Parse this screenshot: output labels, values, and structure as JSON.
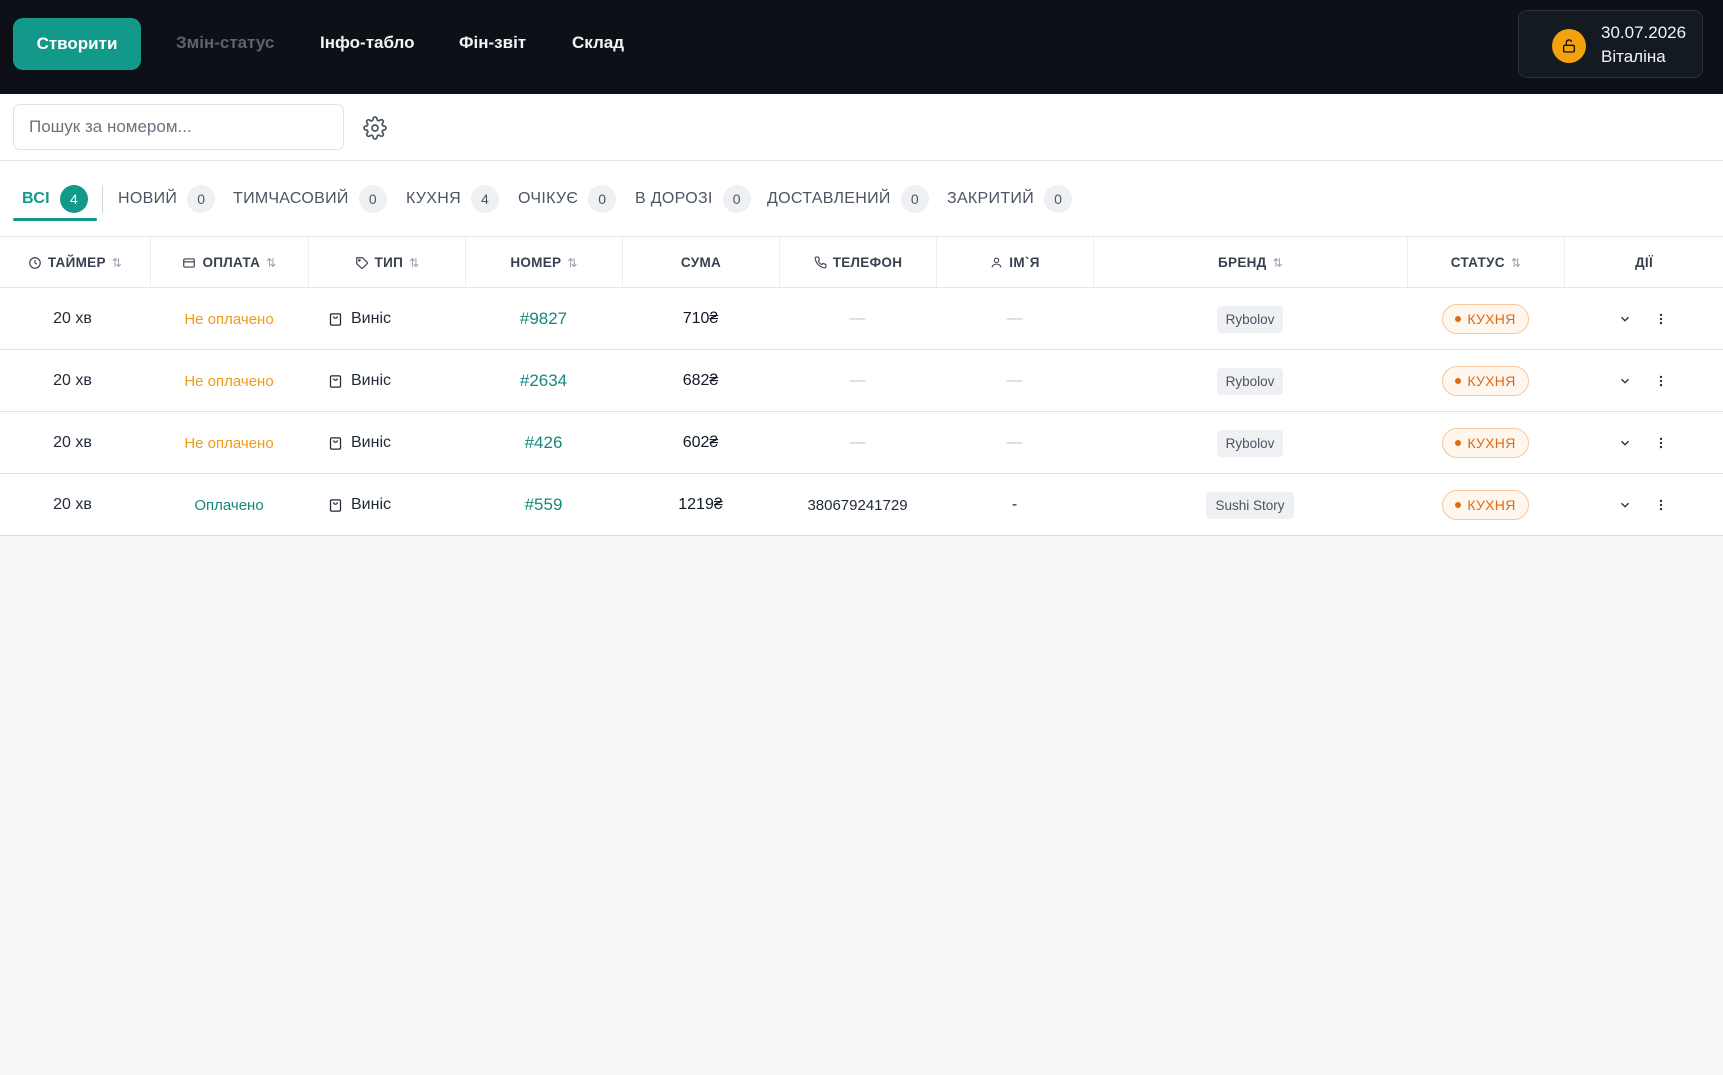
{
  "topbar": {
    "create_label": "Створити",
    "nav": [
      "Змін-статус",
      "Інфо-табло",
      "Фін-звіт",
      "Склад"
    ],
    "user": {
      "date": "30.07.2026",
      "name": "Віталіна"
    }
  },
  "search": {
    "placeholder": "Пошук за номером..."
  },
  "tabs": [
    {
      "label": "ВСІ",
      "count": "4"
    },
    {
      "label": "НОВИЙ",
      "count": "0"
    },
    {
      "label": "ТИМЧАСОВИЙ",
      "count": "0"
    },
    {
      "label": "КУХНЯ",
      "count": "4"
    },
    {
      "label": "ОЧІКУЄ",
      "count": "0"
    },
    {
      "label": "В ДОРОЗІ",
      "count": "0"
    },
    {
      "label": "ДОСТАВЛЕНИЙ",
      "count": "0"
    },
    {
      "label": "ЗАКРИТИЙ",
      "count": "0"
    }
  ],
  "columns": [
    "ТАЙМЕР",
    "ОПЛАТА",
    "ТИП",
    "НОМЕР",
    "СУМА",
    "ТЕЛЕФОН",
    "ІМ`Я",
    "БРЕНД",
    "СТАТУС",
    "ДІЇ"
  ],
  "rows": [
    {
      "timer": "20 хв",
      "payment": "Не оплачено",
      "type": "Винiс",
      "number": "#9827",
      "sum": "710₴",
      "phone": "—",
      "name": "—",
      "brand": "Rybolov",
      "status": "КУХНЯ"
    },
    {
      "timer": "20 хв",
      "payment": "Не оплачено",
      "type": "Винiс",
      "number": "#2634",
      "sum": "682₴",
      "phone": "—",
      "name": "—",
      "brand": "Rybolov",
      "status": "КУХНЯ"
    },
    {
      "timer": "20 хв",
      "payment": "Не оплачено",
      "type": "Винiс",
      "number": "#426",
      "sum": "602₴",
      "phone": "—",
      "name": "—",
      "brand": "Rybolov",
      "status": "КУХНЯ"
    },
    {
      "timer": "20 хв",
      "payment": "Оплачено",
      "type": "Винiс",
      "number": "#559",
      "sum": "1219₴",
      "phone": "380679241729",
      "name": "-",
      "brand": "Sushi Story",
      "status": "КУХНЯ"
    }
  ],
  "colors": {
    "accent": "#13998a",
    "unpaid": "#f29a19",
    "status": "#dc6b11",
    "topbar": "#0d1117"
  }
}
